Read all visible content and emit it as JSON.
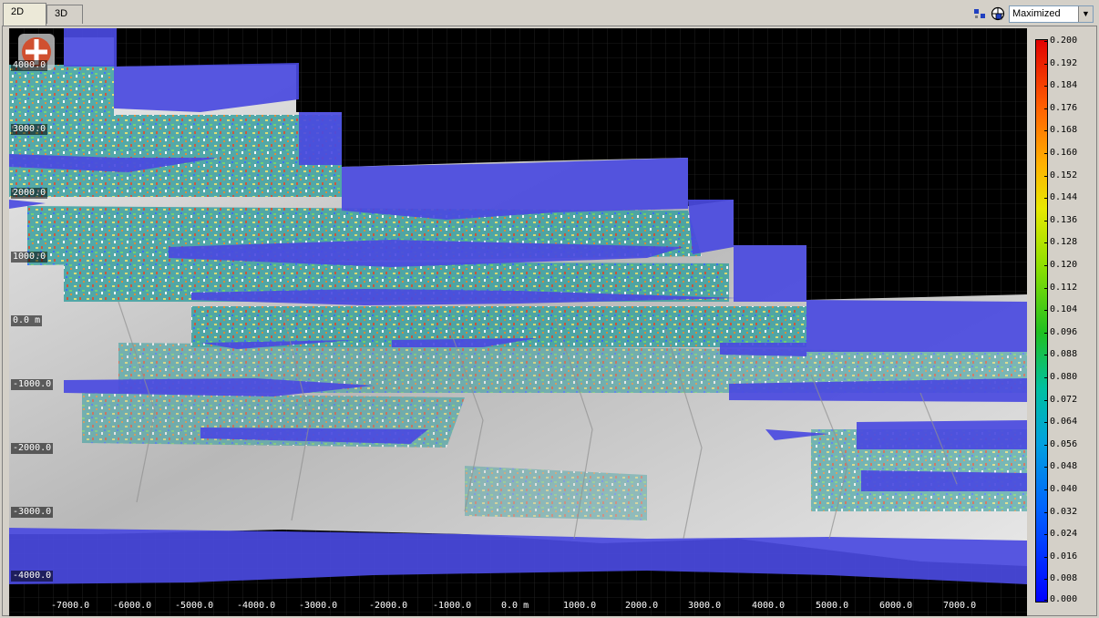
{
  "tabs": [
    {
      "label": "2D",
      "active": true
    },
    {
      "label": "3D",
      "active": false
    }
  ],
  "toolbar": {
    "icons": [
      "grid-dots-icon",
      "globe-lock-icon"
    ],
    "view_mode": {
      "selected": "Maximized"
    }
  },
  "logo": {
    "name": "app-logo-icon"
  },
  "plot": {
    "y_ticks": [
      "4000.0",
      "3000.0",
      "2000.0",
      "1000.0",
      "0.0 m",
      "-1000.0",
      "-2000.0",
      "-3000.0",
      "-4000.0"
    ],
    "x_ticks": [
      "-7000.0",
      "-6000.0",
      "-5000.0",
      "-4000.0",
      "-3000.0",
      "-2000.0",
      "-1000.0",
      "0.0 m",
      "1000.0",
      "2000.0",
      "3000.0",
      "4000.0",
      "5000.0",
      "6000.0",
      "7000.0"
    ]
  },
  "legend": {
    "labels": [
      "0.200",
      "0.192",
      "0.184",
      "0.176",
      "0.168",
      "0.160",
      "0.152",
      "0.144",
      "0.136",
      "0.128",
      "0.120",
      "0.112",
      "0.104",
      "0.096",
      "0.088",
      "0.080",
      "0.072",
      "0.064",
      "0.056",
      "0.048",
      "0.040",
      "0.032",
      "0.024",
      "0.016",
      "0.008",
      "0.000"
    ],
    "colors": {
      "max": "#e00000",
      "mid": "#20c020",
      "min": "#0000ff"
    }
  },
  "colors": {
    "scan_blue": "#4a4ae0",
    "terrain_white": "#d8d8d8",
    "background": "#000000"
  }
}
